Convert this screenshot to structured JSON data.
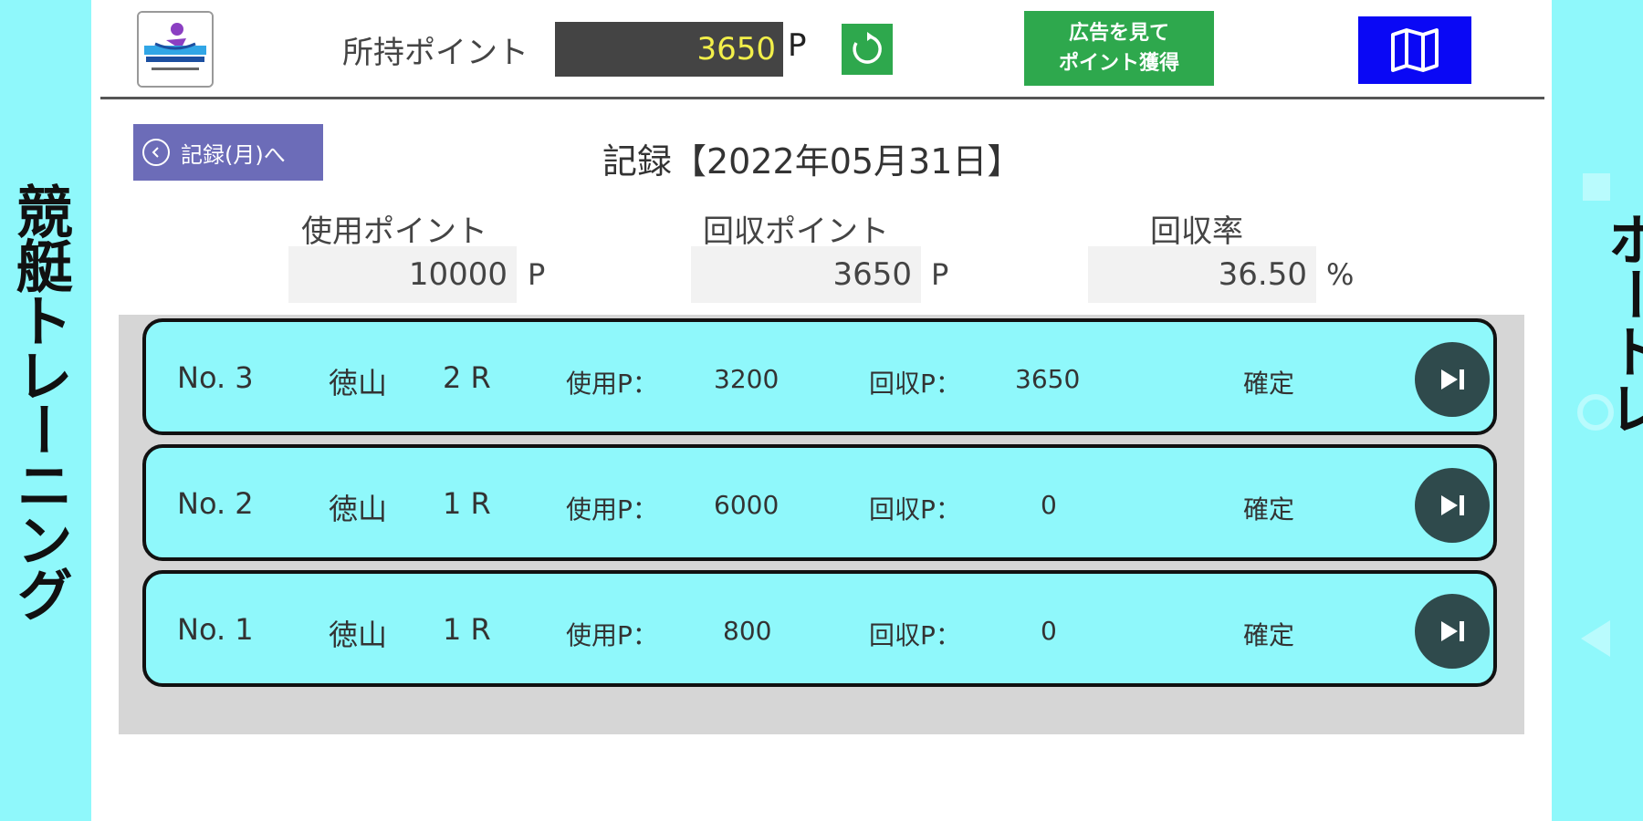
{
  "sidebar_left": {
    "text": "競艇トレーニング"
  },
  "sidebar_right": {
    "text": "ボートレ！"
  },
  "header": {
    "points_label": "所持ポイント",
    "points_value": "3650",
    "points_unit": "P",
    "refresh_icon": "refresh-icon",
    "ad_button_line1": "広告を見て",
    "ad_button_line2": "ポイント獲得",
    "map_icon": "map-icon"
  },
  "nav": {
    "back_label": "記録(月)へ",
    "page_title": "記録【2022年05月31日】"
  },
  "summary": {
    "used_label": "使用ポイント",
    "used_value": "10000",
    "used_unit": "P",
    "recovered_label": "回収ポイント",
    "recovered_value": "3650",
    "recovered_unit": "P",
    "rate_label": "回収率",
    "rate_value": "36.50",
    "rate_unit": "%"
  },
  "records": [
    {
      "no": "No. 3",
      "venue": "徳山",
      "race": "2 R",
      "used_label": "使用P：",
      "used": "3200",
      "recovered_label": "回収P：",
      "recovered": "3650",
      "status": "確定"
    },
    {
      "no": "No. 2",
      "venue": "徳山",
      "race": "1 R",
      "used_label": "使用P：",
      "used": "6000",
      "recovered_label": "回収P：",
      "recovered": "0",
      "status": "確定"
    },
    {
      "no": "No. 1",
      "venue": "徳山",
      "race": "1 R",
      "used_label": "使用P：",
      "used": "800",
      "recovered_label": "回収P：",
      "recovered": "0",
      "status": "確定"
    }
  ],
  "colors": {
    "side_bg": "#8ff8fb",
    "green": "#2ea84d",
    "blue": "#0a08f5",
    "purple": "#6c6cb8",
    "points_text": "#f2ef4a"
  }
}
